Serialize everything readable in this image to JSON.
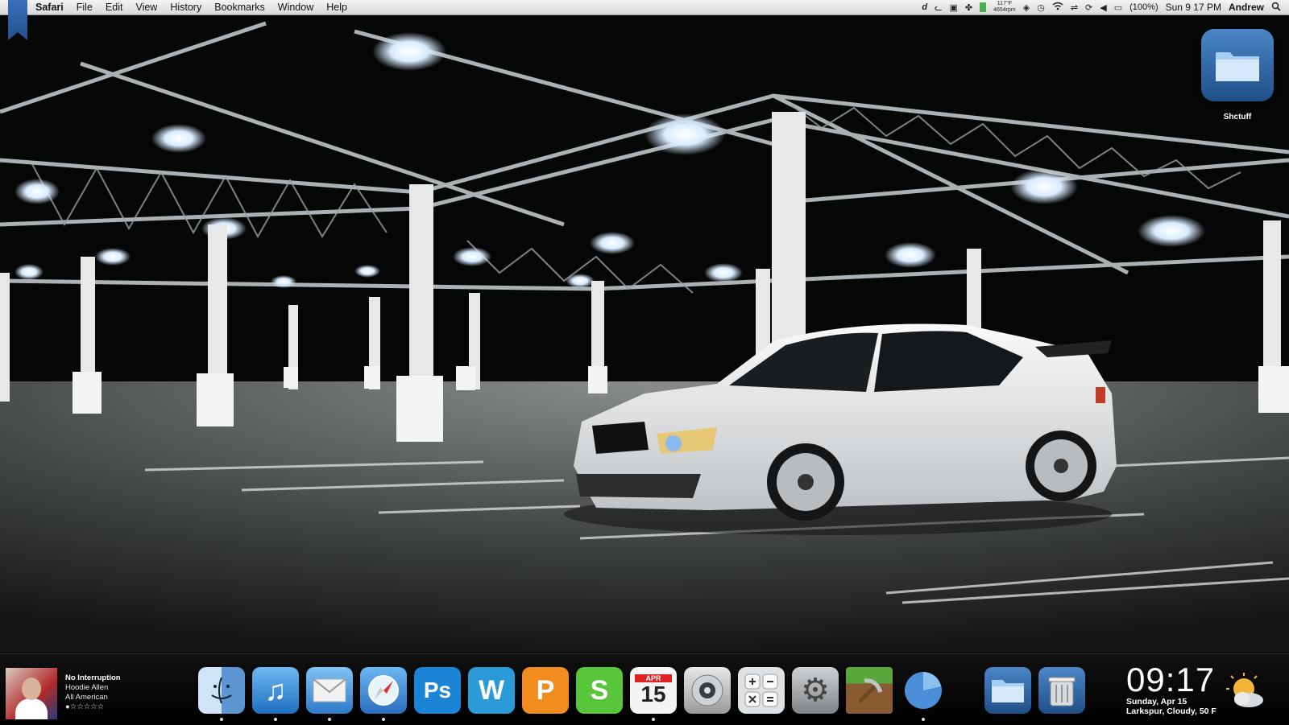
{
  "menubar": {
    "app_name": "Safari",
    "items": [
      "File",
      "Edit",
      "View",
      "History",
      "Bookmarks",
      "Window",
      "Help"
    ],
    "status": {
      "temperature": "117°F",
      "rpm": "4654rpm",
      "battery": "(100%)",
      "clock": "Sun 9 17 PM",
      "user": "Andrew"
    }
  },
  "desktop": {
    "folder_label": "Shctuff"
  },
  "now_playing": {
    "track": "No Interruption",
    "artist": "Hoodie Allen",
    "album": "All American",
    "rating": "●☆☆☆☆☆"
  },
  "dock": {
    "apps": [
      {
        "name": "Finder",
        "icon": "finder-icon",
        "running": true
      },
      {
        "name": "iTunes",
        "icon": "itunes-icon",
        "running": true
      },
      {
        "name": "Mail",
        "icon": "mail-icon",
        "running": true
      },
      {
        "name": "Safari",
        "icon": "safari-icon",
        "running": true
      },
      {
        "name": "Photoshop",
        "icon": "photoshop-icon",
        "glyph": "Ps",
        "running": false
      },
      {
        "name": "Word",
        "icon": "word-icon",
        "glyph": "W",
        "running": false
      },
      {
        "name": "Presentation",
        "icon": "presentation-icon",
        "glyph": "P",
        "running": false
      },
      {
        "name": "Spreadsheet",
        "icon": "spreadsheet-icon",
        "glyph": "S",
        "running": false
      },
      {
        "name": "Calendar",
        "icon": "calendar-icon",
        "month": "APR",
        "day": "15",
        "running": true
      },
      {
        "name": "Disk Utility",
        "icon": "disk-icon",
        "running": false
      },
      {
        "name": "Calculator",
        "icon": "calculator-icon",
        "running": false
      },
      {
        "name": "System Preferences",
        "icon": "gear-icon",
        "running": false
      },
      {
        "name": "Minecraft",
        "icon": "minecraft-icon",
        "running": false
      },
      {
        "name": "Activity",
        "icon": "pie-icon",
        "running": true
      }
    ],
    "stacks": [
      {
        "name": "Documents",
        "icon": "folder-icon"
      },
      {
        "name": "Trash",
        "icon": "trash-icon"
      }
    ]
  },
  "widget": {
    "time": "09:17",
    "date": "Sunday, Apr 15",
    "weather": "Larkspur,  Cloudy, 50 F"
  },
  "colors": {
    "menubar": "#e6e6e6",
    "dock_bg": "#0a0a0a",
    "folder_blue": "#2f6aa8"
  }
}
